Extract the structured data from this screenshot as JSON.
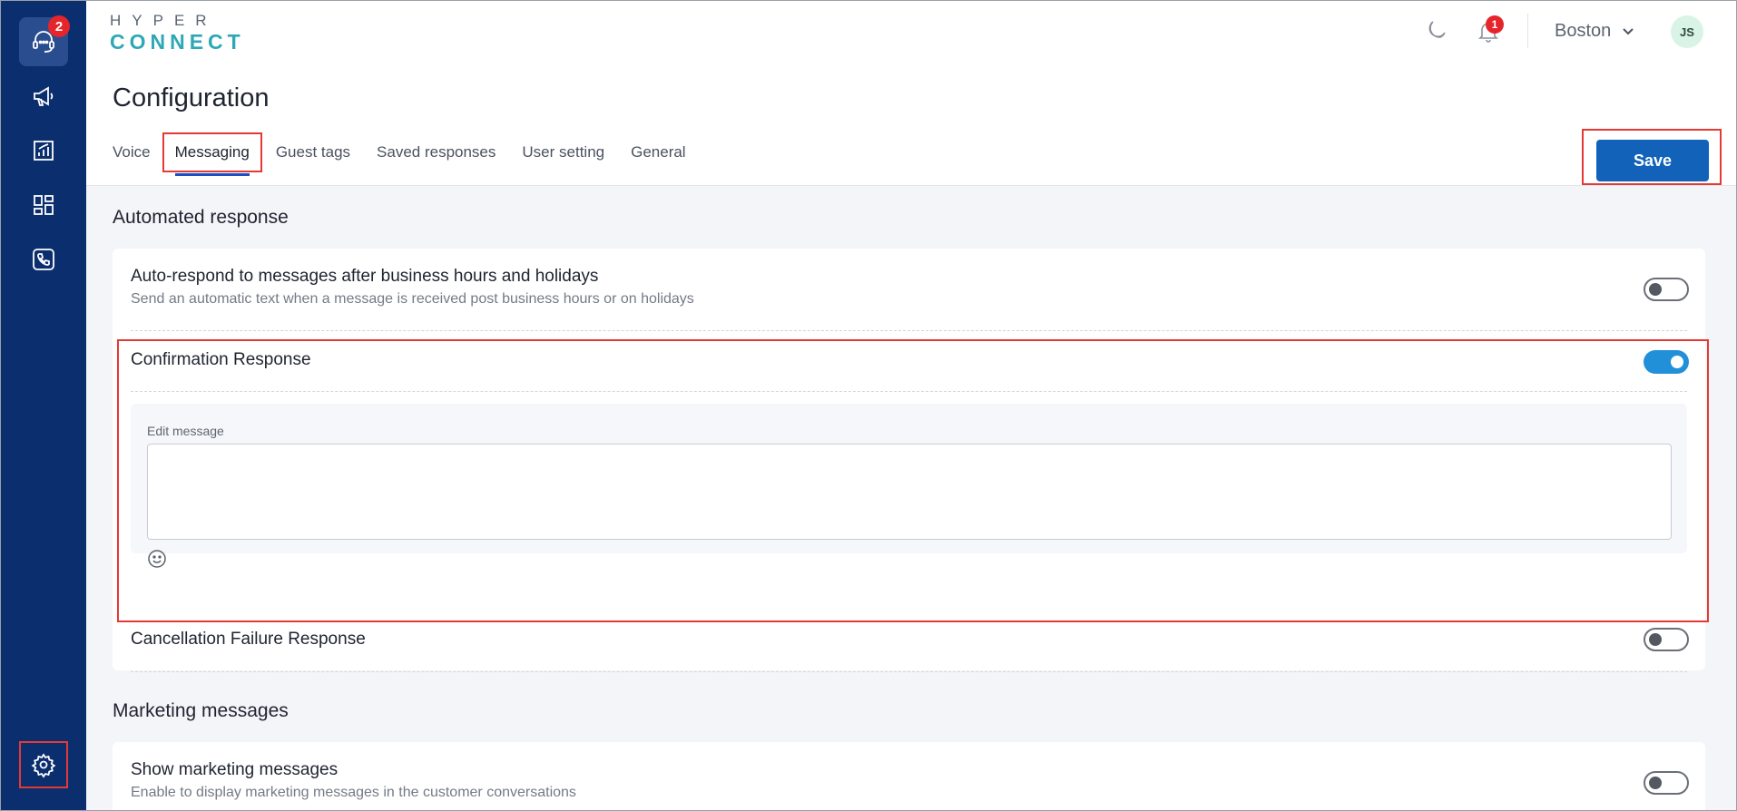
{
  "sidebar": {
    "support_badge": "2",
    "icons": [
      "headset-icon",
      "megaphone-icon",
      "report-icon",
      "dashboard-icon",
      "phone-icon",
      "gear-icon"
    ]
  },
  "header": {
    "logo_top": "HYPER",
    "logo_bottom": "CONNECT",
    "notification_count": "1",
    "location": "Boston",
    "avatar_initials": "JS"
  },
  "page": {
    "title": "Configuration",
    "tabs": [
      {
        "label": "Voice"
      },
      {
        "label": "Messaging"
      },
      {
        "label": "Guest tags"
      },
      {
        "label": "Saved responses"
      },
      {
        "label": "User setting"
      },
      {
        "label": "General"
      }
    ],
    "active_tab": "Messaging",
    "save_label": "Save"
  },
  "automated": {
    "title": "Automated response",
    "auto_respond": {
      "title": "Auto-respond to messages after business hours and holidays",
      "description": "Send an automatic text when a message is received post business hours or on holidays",
      "enabled": false
    },
    "confirmation": {
      "title": "Confirmation Response",
      "enabled": true,
      "editor_label": "Edit message",
      "editor_value": ""
    },
    "cancellation": {
      "title": "Cancellation Failure Response",
      "enabled": false
    }
  },
  "marketing": {
    "title": "Marketing messages",
    "show": {
      "title": "Show marketing messages",
      "description": "Enable to display marketing messages in the customer conversations",
      "enabled": false
    }
  }
}
